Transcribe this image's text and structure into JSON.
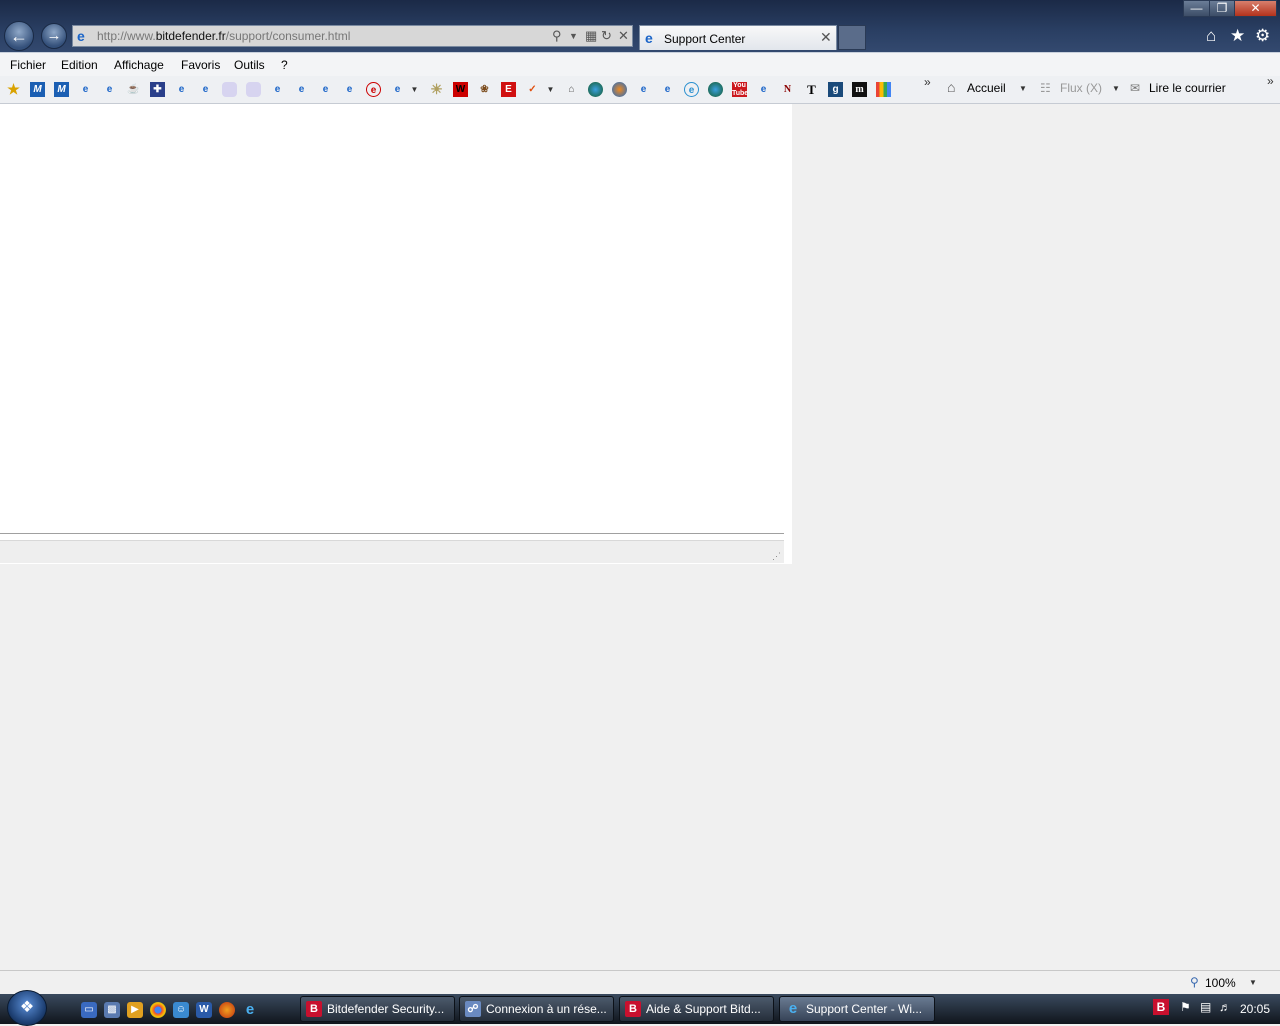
{
  "browser": {
    "address": {
      "url_prefix": "http://www.",
      "url_domain": "bitdefender.fr",
      "url_path": "/support/consumer.html"
    },
    "tab": {
      "title": "Support Center"
    }
  },
  "menu": [
    "Fichier",
    "Edition",
    "Affichage",
    "Favoris",
    "Outils",
    "?"
  ],
  "favorites_bar": {
    "commands": {
      "home_label": "Accueil",
      "feeds_label": "Flux (X)",
      "mail_label": "Lire le courrier"
    }
  },
  "status": {
    "zoom": "100%"
  },
  "taskbar": {
    "tasks": [
      {
        "label": "Bitdefender Security..."
      },
      {
        "label": "Connexion à un rése..."
      },
      {
        "label": "Aide & Support Bitd..."
      },
      {
        "label": "Support Center - Wi..."
      }
    ],
    "clock": "20:05"
  },
  "colors": {
    "titlebar": "#2a3f63",
    "taskbar": "#1e2733",
    "bitdefender_red": "#c8102e"
  }
}
